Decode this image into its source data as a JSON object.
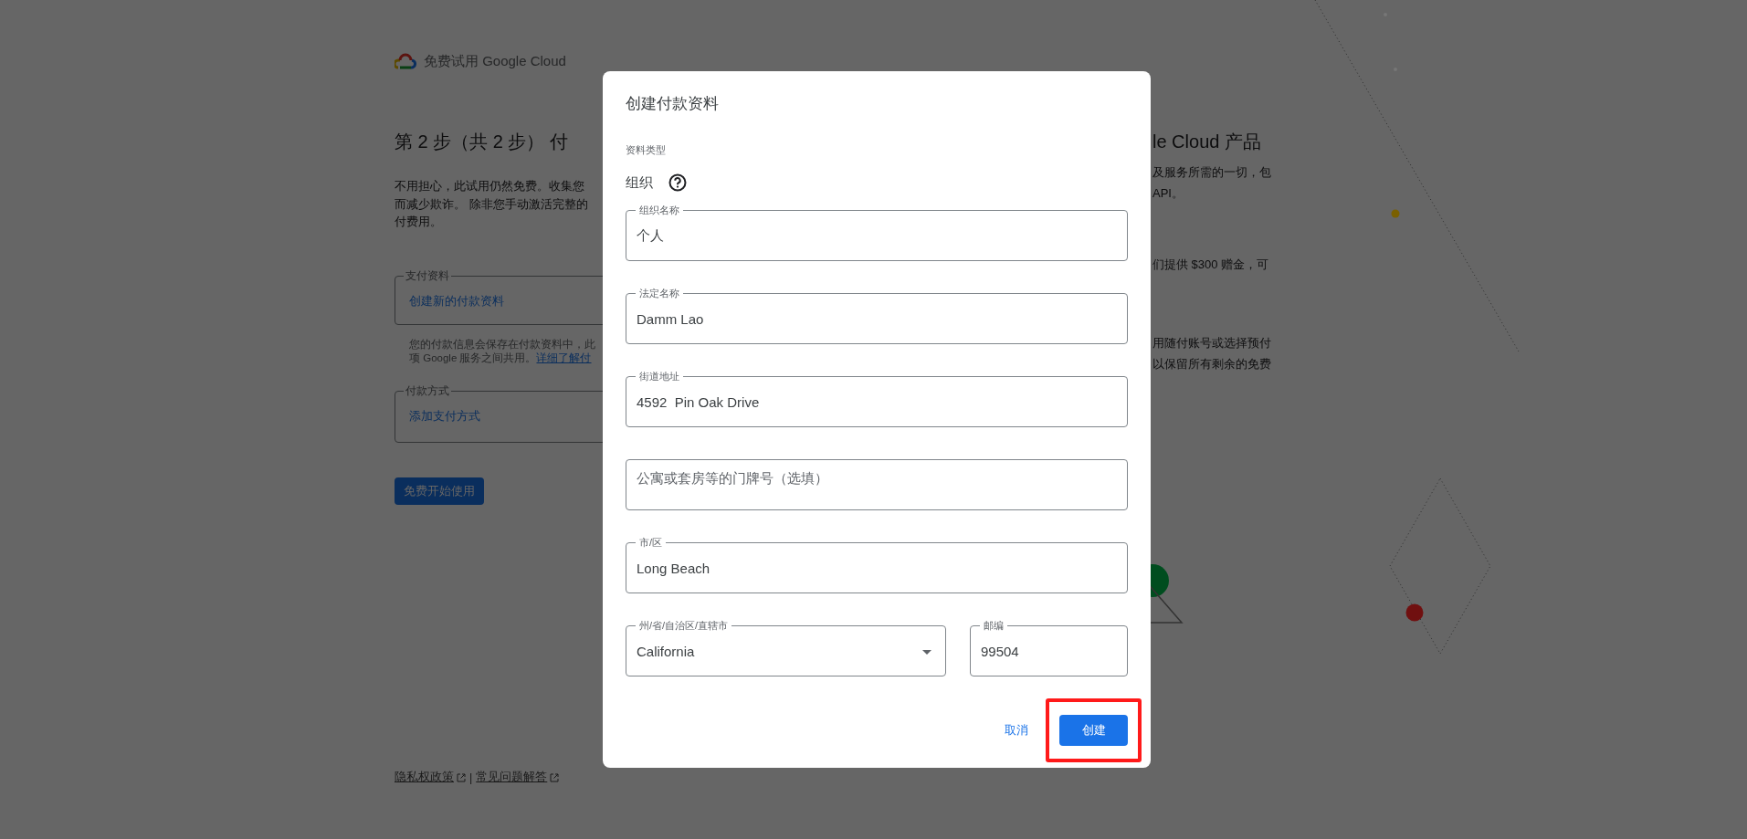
{
  "background_page": {
    "brand": "免费试用 Google Cloud",
    "heading": "第 2 步（共 2 步） 付",
    "intro_lines": [
      "不用担心，此试用仍然免费。收集您",
      "而减少欺诈。 除非您手动激活完整的",
      "付费用。"
    ],
    "payment_profile": {
      "legend": "支付资料",
      "value": "创建新的付款资料"
    },
    "profile_note": {
      "lines": [
        "您的付款信息会保存在付款资料中，此",
        "项 Google 服务之间共用。"
      ],
      "link": "详细了解付"
    },
    "payment_method": {
      "legend": "付款方式",
      "value": "添加支付方式"
    },
    "start_button": "免费开始使用",
    "footer_links": [
      "隐私权政策",
      "常见问题解答"
    ],
    "footer_separator": "|",
    "side_heading": "le Cloud 产品",
    "side_paragraphs": [
      [
        "及服务所需的一切，包",
        "API。"
      ],
      [
        "们提供 $300 赠金，可"
      ],
      [
        "用随付账号或选择预付",
        "以保留所有剩余的免费"
      ]
    ]
  },
  "dialog": {
    "title": "创建付款资料",
    "type_label": "资料类型",
    "type_value": "组织",
    "field_rows": [
      [
        {
          "kind": "text",
          "label": "组织名称",
          "value": "个人"
        }
      ],
      [
        {
          "kind": "text",
          "label": "法定名称",
          "value": "Damm Lao"
        }
      ],
      [
        {
          "kind": "text",
          "label": "街道地址",
          "value": "4592  Pin Oak Drive"
        }
      ],
      [
        {
          "kind": "text",
          "placeholder": "公寓或套房等的门牌号（选填）"
        }
      ],
      [
        {
          "kind": "text",
          "label": "市/区",
          "value": "Long Beach"
        }
      ],
      [
        {
          "kind": "select",
          "label": "州/省/自治区/直辖市",
          "value": "California"
        },
        {
          "kind": "text",
          "label": "邮编",
          "value": "99504"
        }
      ]
    ],
    "buttons": [
      {
        "kind": "text",
        "label": "取消",
        "highlighted": false
      },
      {
        "kind": "primary",
        "label": "创建",
        "highlighted": true
      }
    ]
  }
}
